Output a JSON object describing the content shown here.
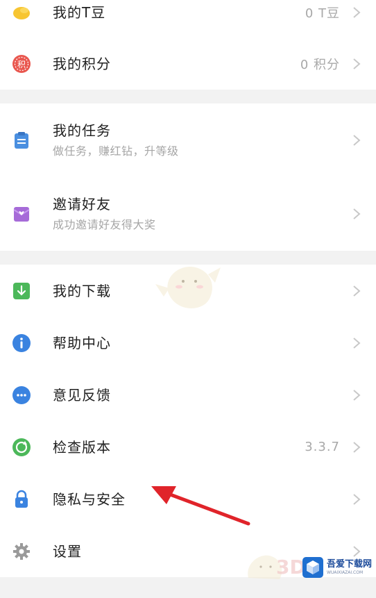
{
  "groups": [
    {
      "items": [
        {
          "title": "我的T豆",
          "value": "0 T豆",
          "icon": "coin-icon"
        },
        {
          "title": "我的积分",
          "value": "0 积分",
          "icon": "points-icon"
        }
      ]
    },
    {
      "items": [
        {
          "title": "我的任务",
          "subtitle": "做任务，赚红钻，升等级",
          "icon": "clipboard-icon"
        },
        {
          "title": "邀请好友",
          "subtitle": "成功邀请好友得大奖",
          "icon": "gift-icon"
        }
      ]
    },
    {
      "items": [
        {
          "title": "我的下载",
          "icon": "download-icon"
        },
        {
          "title": "帮助中心",
          "icon": "info-icon"
        },
        {
          "title": "意见反馈",
          "icon": "feedback-icon"
        },
        {
          "title": "检查版本",
          "value": "3.3.7",
          "icon": "refresh-icon"
        },
        {
          "title": "隐私与安全",
          "icon": "lock-icon"
        },
        {
          "title": "设置",
          "icon": "gear-icon"
        }
      ]
    }
  ],
  "colors": {
    "coin": "#f7c531",
    "points": "#e9574f",
    "task": "#4a8fe0",
    "gift": "#a66bd8",
    "download": "#4cb85a",
    "info": "#3a83e0",
    "feedback": "#3a83e0",
    "version": "#4cb85a",
    "lock": "#3a83e0",
    "gear": "#9a9a9a",
    "arrow": "#e0242a"
  },
  "watermark": {
    "brand_name": "吾爱下载网",
    "brand_url": "WUAIXIAZAI.COM",
    "mark_3d": "3D"
  }
}
